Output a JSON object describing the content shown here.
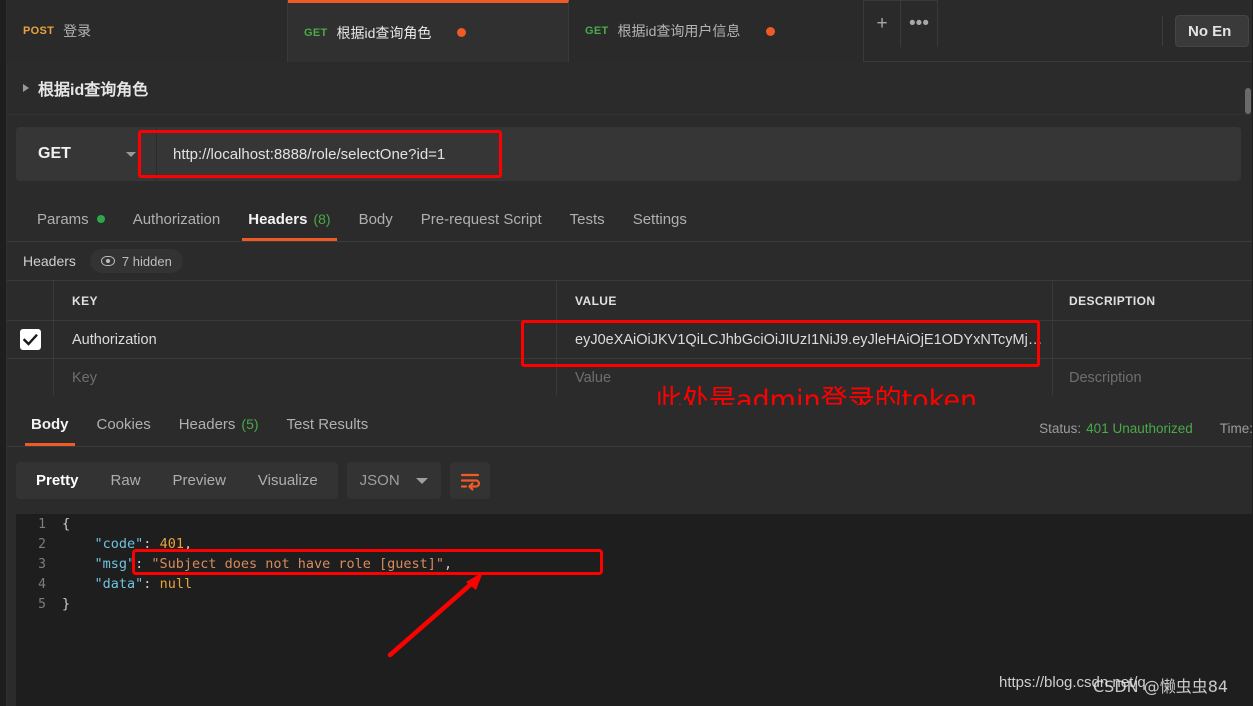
{
  "window": {
    "environment_label": "No En"
  },
  "request_tabs": [
    {
      "method": "POST",
      "name": "登录",
      "active": false,
      "unsaved": false
    },
    {
      "method": "GET",
      "name": "根据id查询角色",
      "active": true,
      "unsaved": true
    },
    {
      "method": "GET",
      "name": "根据id查询用户信息",
      "active": false,
      "unsaved": true
    }
  ],
  "tab_controls": {
    "new_tab": "+",
    "more": "•••"
  },
  "breadcrumb": {
    "title": "根据id查询角色"
  },
  "url_bar": {
    "method": "GET",
    "url": "http://localhost:8888/role/selectOne?id=1"
  },
  "request_tabs_row": [
    {
      "label": "Params",
      "active": false,
      "dot": true,
      "count": ""
    },
    {
      "label": "Authorization",
      "active": false,
      "dot": false,
      "count": ""
    },
    {
      "label": "Headers",
      "active": true,
      "dot": false,
      "count": "(8)"
    },
    {
      "label": "Body",
      "active": false,
      "dot": false,
      "count": ""
    },
    {
      "label": "Pre-request Script",
      "active": false,
      "dot": false,
      "count": ""
    },
    {
      "label": "Tests",
      "active": false,
      "dot": false,
      "count": ""
    },
    {
      "label": "Settings",
      "active": false,
      "dot": false,
      "count": ""
    }
  ],
  "headers_panel": {
    "title": "Headers",
    "hidden_label": "7 hidden"
  },
  "headers_table": {
    "columns": [
      "KEY",
      "VALUE",
      "DESCRIPTION"
    ],
    "rows": [
      {
        "checked": true,
        "key": "Authorization",
        "value": "eyJ0eXAiOiJKV1QiLCJhbGciOiJIUzI1NiJ9.eyJleHAiOjE1ODYxNTcyMjAs …",
        "description": ""
      }
    ],
    "placeholder_row": {
      "key": "Key",
      "value": "Value",
      "description": "Description"
    }
  },
  "annotations": {
    "token_note": "此处是admin登录的token"
  },
  "response_tabs": [
    {
      "label": "Body",
      "active": true,
      "count": ""
    },
    {
      "label": "Cookies",
      "active": false,
      "count": ""
    },
    {
      "label": "Headers",
      "active": false,
      "count": "(5)"
    },
    {
      "label": "Test Results",
      "active": false,
      "count": ""
    }
  ],
  "response_status": {
    "status_label": "Status:",
    "status_value": "401 Unauthorized",
    "time_label": "Time:"
  },
  "response_toolbar": {
    "views": [
      {
        "label": "Pretty",
        "active": true
      },
      {
        "label": "Raw",
        "active": false
      },
      {
        "label": "Preview",
        "active": false
      },
      {
        "label": "Visualize",
        "active": false
      }
    ],
    "format": "JSON",
    "wrap_icon": "word-wrap-icon"
  },
  "response_body": {
    "lines": [
      {
        "n": "1",
        "segments": [
          {
            "t": "{",
            "c": "k-brace"
          }
        ]
      },
      {
        "n": "2",
        "segments": [
          {
            "t": "    ",
            "c": ""
          },
          {
            "t": "\"code\"",
            "c": "k-key"
          },
          {
            "t": ": ",
            "c": "k-brace"
          },
          {
            "t": "401",
            "c": "k-num"
          },
          {
            "t": ",",
            "c": "k-brace"
          }
        ]
      },
      {
        "n": "3",
        "segments": [
          {
            "t": "    ",
            "c": ""
          },
          {
            "t": "\"msg\"",
            "c": "k-key"
          },
          {
            "t": ": ",
            "c": "k-brace"
          },
          {
            "t": "\"Subject does not have role [guest]\"",
            "c": "k-str"
          },
          {
            "t": ",",
            "c": "k-brace"
          }
        ]
      },
      {
        "n": "4",
        "segments": [
          {
            "t": "    ",
            "c": ""
          },
          {
            "t": "\"data\"",
            "c": "k-key"
          },
          {
            "t": ": ",
            "c": "k-brace"
          },
          {
            "t": "null",
            "c": "k-null"
          }
        ]
      },
      {
        "n": "5",
        "segments": [
          {
            "t": "}",
            "c": "k-brace"
          }
        ]
      }
    ],
    "raw": "{\n    \"code\": 401,\n    \"msg\": \"Subject does not have role [guest]\",\n    \"data\": null\n}"
  },
  "watermarks": {
    "blog_url": "https://blog.csdn.net/q",
    "csdn": "CSDN @懒虫虫84"
  },
  "colors": {
    "accent": "#ef5b25",
    "annotation_red": "#ff0000",
    "success_green": "#4aa94a",
    "post_orange": "#e8a33d",
    "panel_bg": "#2b2b2b",
    "code_bg": "#1e1e1e"
  }
}
